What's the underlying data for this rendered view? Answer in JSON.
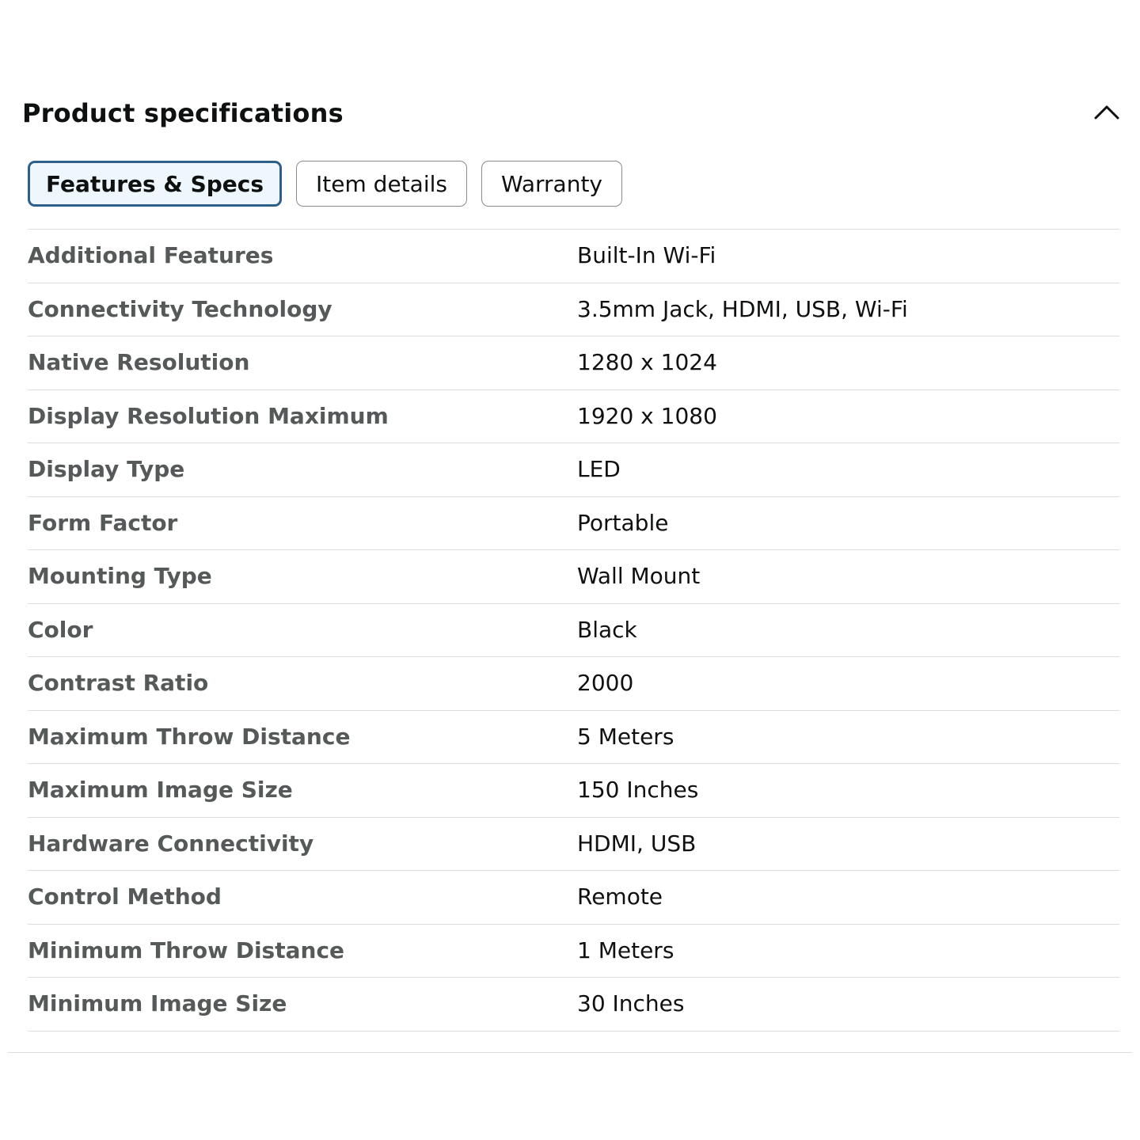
{
  "header": {
    "title": "Product specifications",
    "collapse_icon": "chevron-up-icon"
  },
  "tabs": [
    {
      "label": "Features & Specs",
      "active": true
    },
    {
      "label": "Item details",
      "active": false
    },
    {
      "label": "Warranty",
      "active": false
    }
  ],
  "specs": [
    {
      "label": "Additional Features",
      "value": "Built-In Wi-Fi"
    },
    {
      "label": "Connectivity Technology",
      "value": "3.5mm Jack, HDMI, USB, Wi-Fi"
    },
    {
      "label": "Native Resolution",
      "value": "1280 x 1024"
    },
    {
      "label": "Display Resolution Maximum",
      "value": "1920 x 1080"
    },
    {
      "label": "Display Type",
      "value": "LED"
    },
    {
      "label": "Form Factor",
      "value": "Portable"
    },
    {
      "label": "Mounting Type",
      "value": "Wall Mount"
    },
    {
      "label": "Color",
      "value": "Black"
    },
    {
      "label": "Contrast Ratio",
      "value": "2000"
    },
    {
      "label": "Maximum Throw Distance",
      "value": "5 Meters"
    },
    {
      "label": "Maximum Image Size",
      "value": "150 Inches"
    },
    {
      "label": "Hardware Connectivity",
      "value": "HDMI, USB"
    },
    {
      "label": "Control Method",
      "value": "Remote"
    },
    {
      "label": "Minimum Throw Distance",
      "value": "1 Meters"
    },
    {
      "label": "Minimum Image Size",
      "value": "30 Inches"
    }
  ],
  "colors": {
    "active_tab_border": "#2e5f8a",
    "active_tab_background": "#edf7fd",
    "label_text": "#565959",
    "value_text": "#0f1111"
  }
}
